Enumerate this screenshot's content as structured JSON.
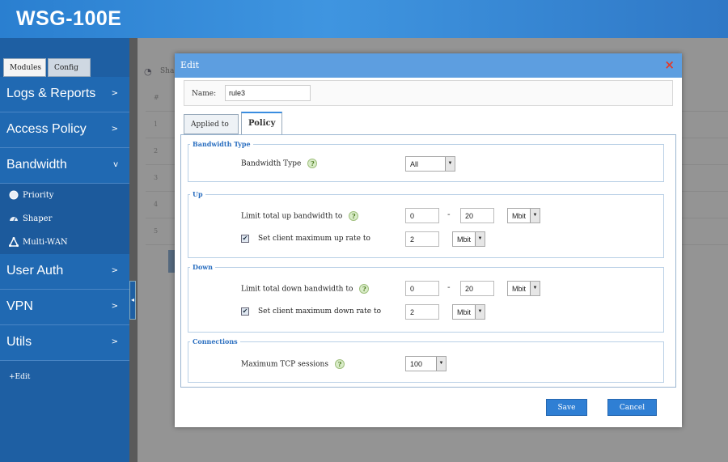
{
  "app": {
    "title": "WSG-100E"
  },
  "sidebar": {
    "tabs": [
      "Modules",
      "Config"
    ],
    "menu": [
      {
        "label": "Logs & Reports",
        "arrow": ">"
      },
      {
        "label": "Access Policy",
        "arrow": ">"
      },
      {
        "label": "Bandwidth",
        "arrow": "v"
      },
      {
        "label": "User Auth",
        "arrow": ">"
      },
      {
        "label": "VPN",
        "arrow": ">"
      },
      {
        "label": "Utils",
        "arrow": ">"
      }
    ],
    "bandwidth_sub": [
      "Priority",
      "Shaper",
      "Multi-WAN"
    ],
    "edit_link": "+Edit"
  },
  "background": {
    "crumb": "Sha",
    "header_col": "#",
    "rows": [
      "1",
      "2",
      "3",
      "4",
      "5"
    ]
  },
  "modal": {
    "title": "Edit",
    "close": "×",
    "name_label": "Name:",
    "name_value": "rule3",
    "tabs": {
      "applied": "Applied to",
      "policy": "Policy"
    },
    "bandwidth_type": {
      "legend": "Bandwidth Type",
      "label": "Bandwidth Type",
      "value": "All"
    },
    "up": {
      "legend": "Up",
      "total_label": "Limit total up bandwidth to",
      "total_min": "0",
      "total_max": "20",
      "total_unit": "Mbit",
      "client_label": "Set client maximum up rate to",
      "client_checked": true,
      "client_value": "2",
      "client_unit": "Mbit"
    },
    "down": {
      "legend": "Down",
      "total_label": "Limit total down bandwidth to",
      "total_min": "0",
      "total_max": "20",
      "total_unit": "Mbit",
      "client_label": "Set client maximum down rate to",
      "client_checked": true,
      "client_value": "2",
      "client_unit": "Mbit"
    },
    "connections": {
      "legend": "Connections",
      "label": "Maximum TCP sessions",
      "value": "100"
    },
    "help_glyph": "?",
    "dash": "-",
    "buttons": {
      "save": "Save",
      "cancel": "Cancel"
    }
  },
  "colors": {
    "header": "#3f95e0",
    "sidebar": "#2069b2",
    "button": "#2f7fd4",
    "close": "#e23b2a",
    "legend": "#2b6fc0"
  }
}
